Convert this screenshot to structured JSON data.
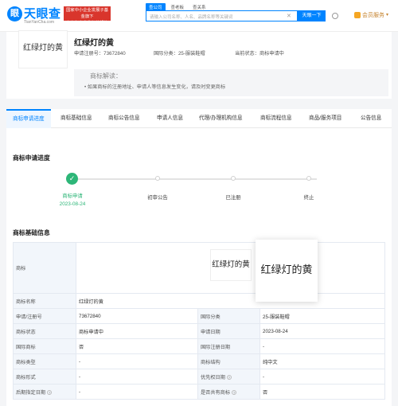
{
  "header": {
    "logo_text": "天眼查",
    "logo_sub": "TianYanCha.com",
    "banner_line1": "国家中小企业发展子基金旗下",
    "banner_line2": "官方备案企业征信机构",
    "search_tabs": [
      "查公司",
      "查老板",
      "查关系"
    ],
    "search_placeholder": "请输入公司名称、人名、品牌名称等关键词",
    "search_button": "天眼一下",
    "vip_label": "会员服务"
  },
  "trademark": {
    "image_text": "红绿灯的黄",
    "name": "红绿灯的黄",
    "reg_no_label": "申请注册号：",
    "reg_no": "73672840",
    "class_label": "国际分类：",
    "class_value": "25-服装鞋帽",
    "status_label": "当前状态：",
    "status_value": "商标申请中",
    "notice_title": "商标解读：",
    "notice_body": "如果商标的注册地址、申请人等信息发生变化，请及时变更商标"
  },
  "tabs": [
    "商标申请进度",
    "商标基础信息",
    "商标公告信息",
    "申请人信息",
    "代理/办理机构信息",
    "商标流程信息",
    "商品/服务项目",
    "公告信息"
  ],
  "progress": {
    "title": "商标申请进度",
    "steps": [
      {
        "label": "商标申请",
        "date": "2023-08-24"
      },
      {
        "label": "初审公告",
        "date": ""
      },
      {
        "label": "已注册",
        "date": ""
      },
      {
        "label": "终止",
        "date": ""
      }
    ]
  },
  "basic": {
    "title": "商标基础信息",
    "img_label": "商标",
    "img_text": "红绿灯的黄",
    "rows": [
      [
        "商标名称",
        "红绿灯的黄",
        "",
        ""
      ],
      [
        "申请/注册号",
        "73672840",
        "国际分类",
        "25-服装鞋帽"
      ],
      [
        "商标状态",
        "商标申请中",
        "申请日期",
        "2023-08-24"
      ],
      [
        "国际商标",
        "否",
        "国际注册日期",
        "-"
      ],
      [
        "商标类型",
        "-",
        "商标结构",
        "纯中文"
      ],
      [
        "商标形式",
        "-",
        "优先权日期",
        "-"
      ],
      [
        "后期指定日期",
        "-",
        "是否共有商标",
        "否"
      ]
    ]
  },
  "colors": {
    "accent": "#0084ff",
    "success": "#2db678",
    "banner": "#d9352c"
  }
}
